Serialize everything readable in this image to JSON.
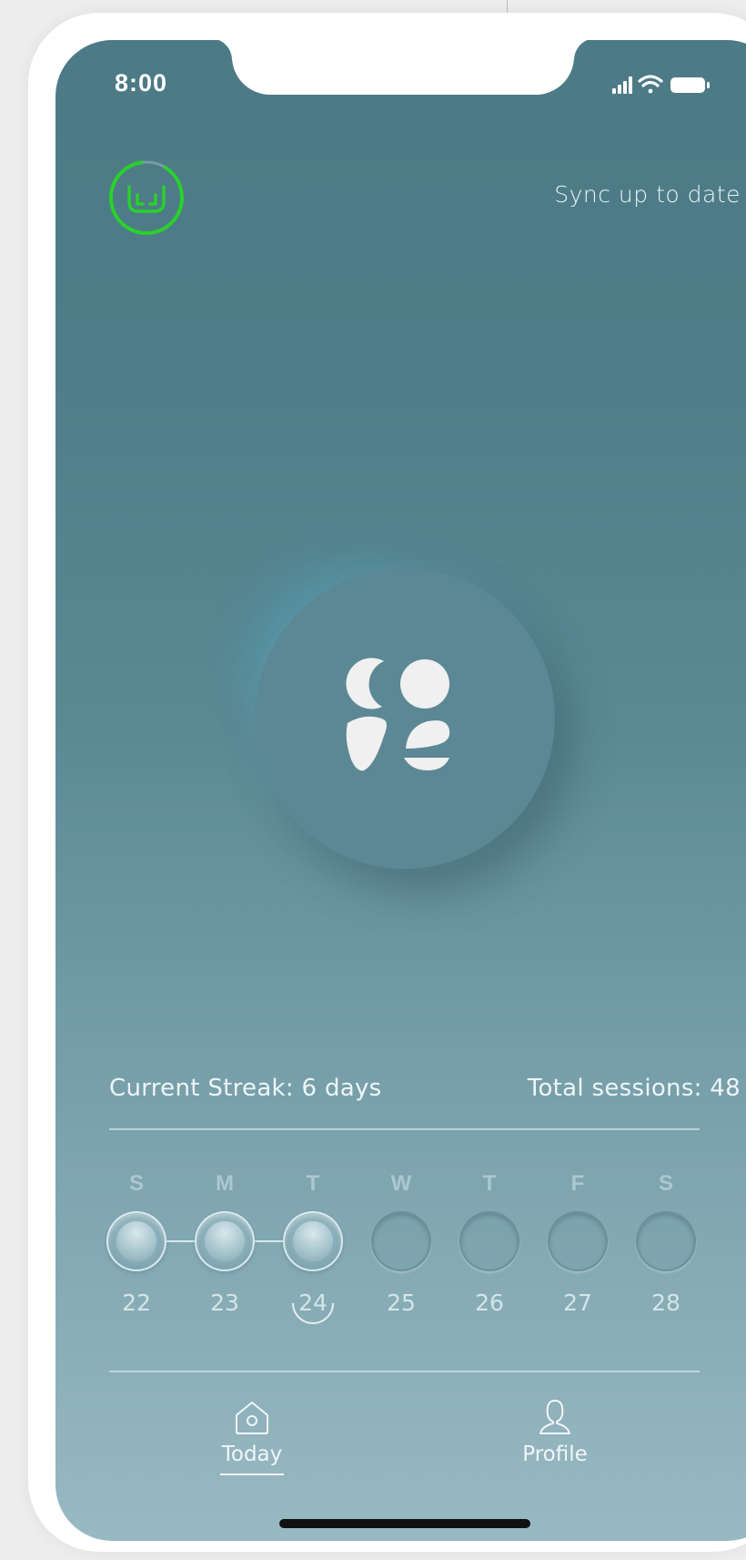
{
  "status_bar": {
    "time": "8:00",
    "icons": [
      "signal-icon",
      "wifi-icon",
      "battery-icon"
    ]
  },
  "header": {
    "sync_status": "Sync up to date",
    "device_icon": "headband-icon",
    "device_ring_color": "#2ad12a"
  },
  "center": {
    "logo_icon": "app-logo-icon"
  },
  "stats": {
    "streak": "Current Streak: 6 days",
    "sessions": "Total sessions: 48"
  },
  "week": {
    "days": [
      {
        "letter": "S",
        "date": "22",
        "completed": true
      },
      {
        "letter": "M",
        "date": "23",
        "completed": true
      },
      {
        "letter": "T",
        "date": "24",
        "completed": true,
        "today": true
      },
      {
        "letter": "W",
        "date": "25",
        "completed": false
      },
      {
        "letter": "T",
        "date": "26",
        "completed": false
      },
      {
        "letter": "F",
        "date": "27",
        "completed": false
      },
      {
        "letter": "S",
        "date": "28",
        "completed": false
      }
    ]
  },
  "tabs": [
    {
      "label": "Today",
      "icon": "home-icon",
      "active": true
    },
    {
      "label": "Profile",
      "icon": "profile-icon",
      "active": false
    }
  ],
  "colors": {
    "accent_green": "#2ad12a",
    "bg_top": "#4c7a86",
    "bg_bottom": "#98b9c2"
  }
}
